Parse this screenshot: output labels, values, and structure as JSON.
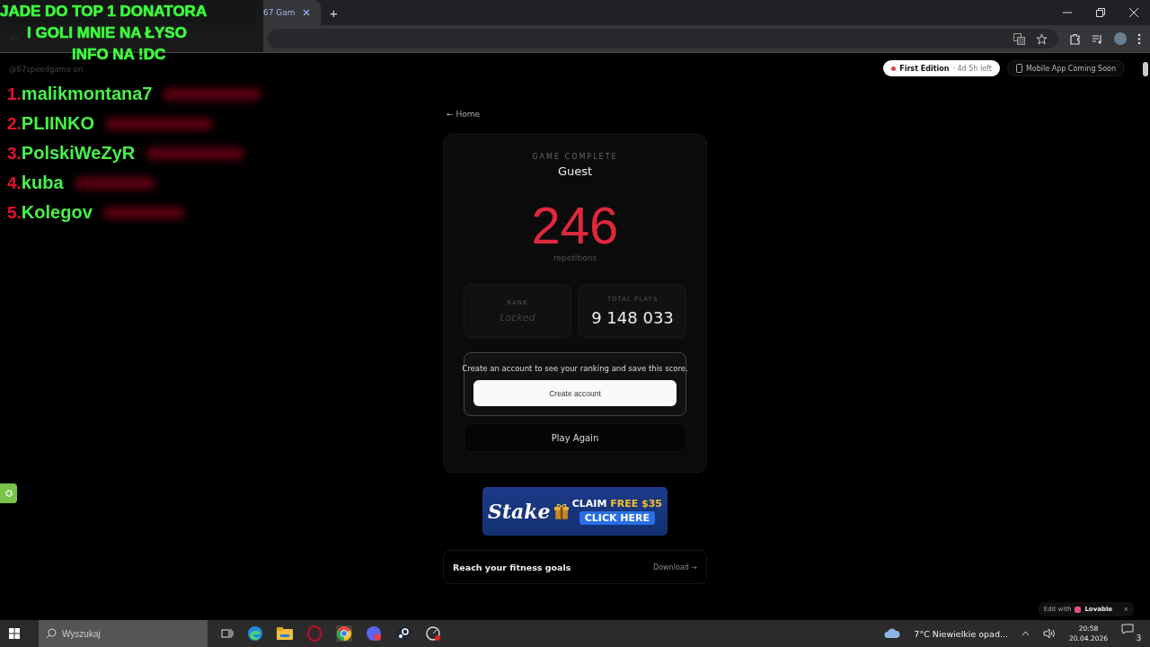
{
  "browser": {
    "active_tab": "67 Gam",
    "buttons": [
      "+"
    ]
  },
  "overlay": {
    "lines": [
      "JADE DO TOP 1 DONATORA",
      "I GOLI MNIE NA ŁYSO",
      "INFO NA !DC"
    ],
    "handle": "@67speedgame on",
    "leaderboard": [
      {
        "rank": "1.",
        "name": "malikmontana7"
      },
      {
        "rank": "2.",
        "name": "PLIINKO"
      },
      {
        "rank": "3.",
        "name": "PolskiWeZyR"
      },
      {
        "rank": "4.",
        "name": "kuba"
      },
      {
        "rank": "5.",
        "name": "Kolegov"
      }
    ]
  },
  "header": {
    "edition": {
      "label": "First Edition",
      "time": "· 4d 5h left",
      "color": "#e0404f"
    },
    "mobile": "Mobile App Coming Soon"
  },
  "home_link": "← Home",
  "result": {
    "eyebrow": "GAME COMPLETE",
    "player": "Guest",
    "score": "246",
    "unit": "repetitions",
    "stats": [
      {
        "label": "RANK",
        "value": "Locked",
        "locked": true
      },
      {
        "label": "TOTAL PLAYS",
        "value": "9 148 033",
        "locked": false
      }
    ],
    "prompt": "Create an account to see your ranking and save this score.",
    "create_button": "Create account",
    "play_again": "Play Again"
  },
  "ad": {
    "brand": "Stake",
    "claim": "CLAIM",
    "offer": "FREE $35",
    "cta": "CLICK HERE"
  },
  "promo": {
    "text": "Reach your fitness goals",
    "link": "Download →"
  },
  "lovable": {
    "prefix": "Edit with",
    "brand": "Lovable",
    "close": "×"
  },
  "taskbar": {
    "search_placeholder": "Wyszukaj",
    "weather": "7°C  Niewielkie opad...",
    "time": "20:58",
    "date": "20.04.2026",
    "notifications": "3"
  }
}
